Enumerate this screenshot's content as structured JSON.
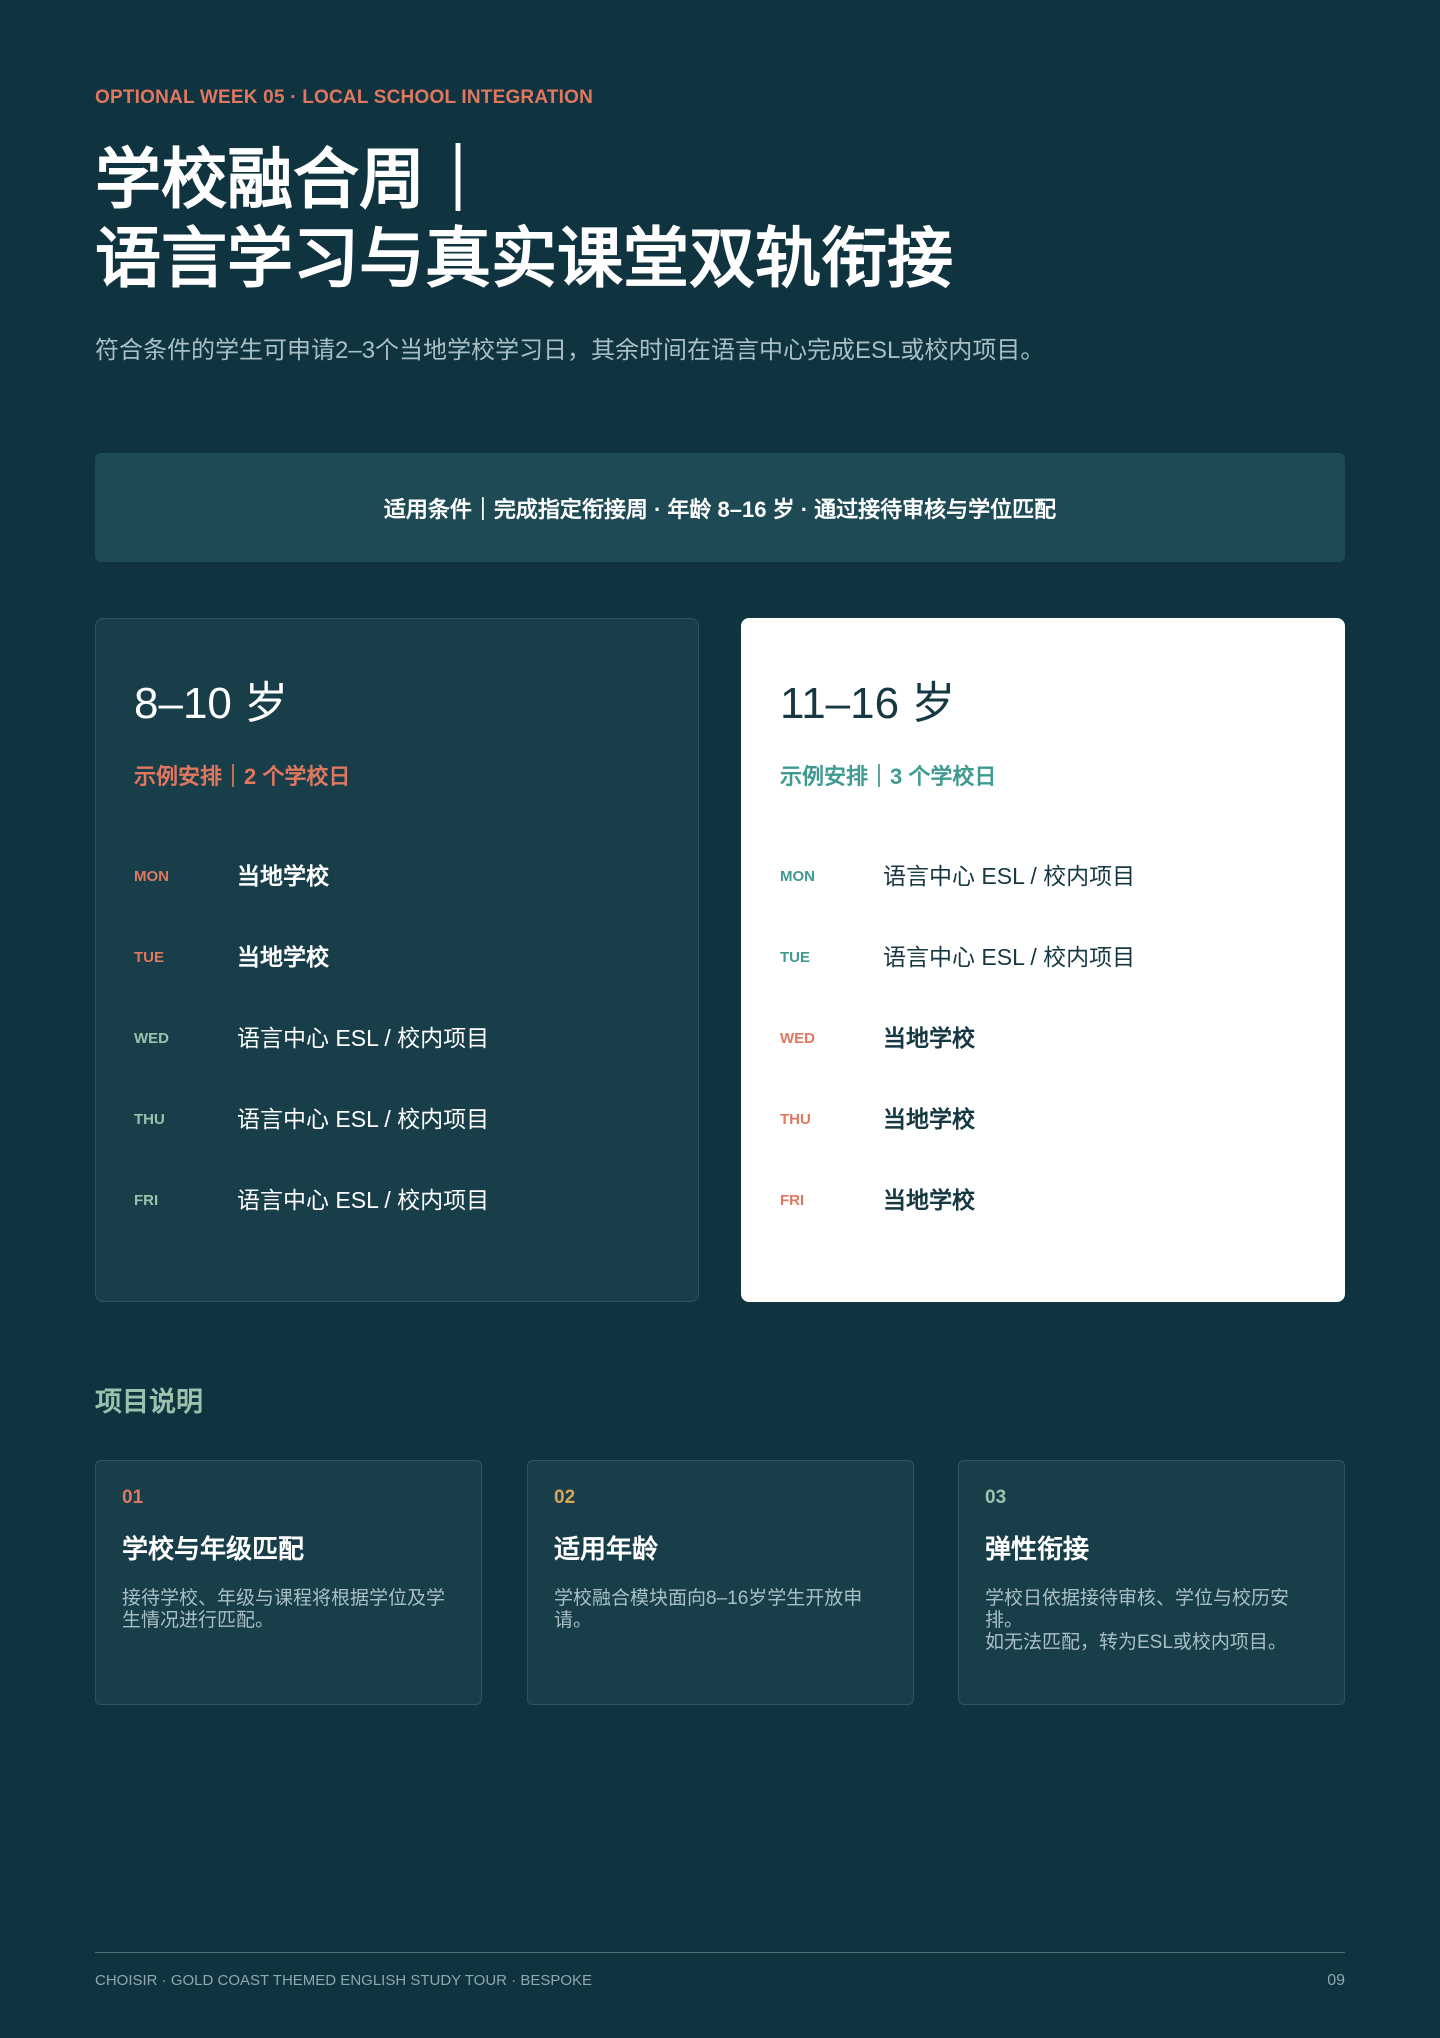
{
  "header": {
    "eyebrow": "OPTIONAL WEEK 05 · LOCAL SCHOOL INTEGRATION",
    "title_line1": "学校融合周｜",
    "title_line2": "语言学习与真实课堂双轨衔接",
    "subtitle": "符合条件的学生可申请2–3个当地学校学习日，其余时间在语言中心完成ESL或校内项目。"
  },
  "conditions": "适用条件｜完成指定衔接周 · 年龄 8–16 岁 · 通过接待审核与学位匹配",
  "cards": [
    {
      "age": "8–10 岁",
      "sub": "示例安排｜2 个学校日",
      "days": [
        {
          "day": "MON",
          "activity": "当地学校"
        },
        {
          "day": "TUE",
          "activity": "当地学校"
        },
        {
          "day": "WED",
          "activity": "语言中心 ESL / 校内项目"
        },
        {
          "day": "THU",
          "activity": "语言中心 ESL / 校内项目"
        },
        {
          "day": "FRI",
          "activity": "语言中心 ESL / 校内项目"
        }
      ]
    },
    {
      "age": "11–16 岁",
      "sub": "示例安排｜3 个学校日",
      "days": [
        {
          "day": "MON",
          "activity": "语言中心 ESL / 校内项目"
        },
        {
          "day": "TUE",
          "activity": "语言中心 ESL / 校内项目"
        },
        {
          "day": "WED",
          "activity": "当地学校"
        },
        {
          "day": "THU",
          "activity": "当地学校"
        },
        {
          "day": "FRI",
          "activity": "当地学校"
        }
      ]
    }
  ],
  "notes": {
    "section_title": "项目说明",
    "items": [
      {
        "num": "01",
        "title": "学校与年级匹配",
        "body": "接待学校、年级与课程将根据学位及学生情况进行匹配。"
      },
      {
        "num": "02",
        "title": "适用年龄",
        "body": "学校融合模块面向8–16岁学生开放申请。"
      },
      {
        "num": "03",
        "title": "弹性衔接",
        "body": "学校日依据接待审核、学位与校历安排。\n如无法匹配，转为ESL或校内项目。"
      }
    ]
  },
  "footer": {
    "left": "CHOISIR · GOLD COAST THEMED ENGLISH STUDY TOUR · BESPOKE",
    "page": "09"
  },
  "colors": {
    "background": "#0f3440",
    "coral": "#e0775e",
    "teal": "#3f9a91",
    "sage": "#9cc2ad",
    "gold": "#d9a556"
  }
}
